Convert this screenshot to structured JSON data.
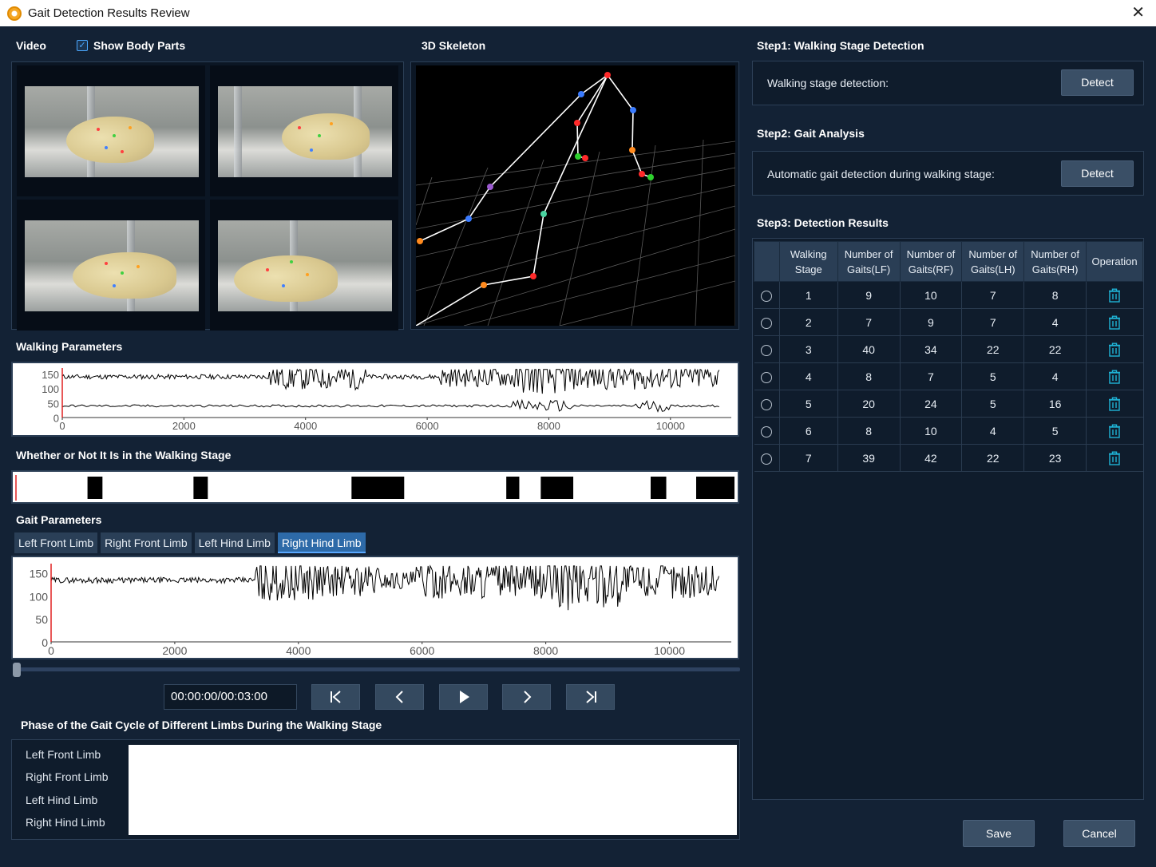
{
  "window": {
    "title": "Gait Detection Results Review",
    "close_glyph": "✕"
  },
  "video": {
    "title": "Video",
    "show_body_parts_label": "Show Body Parts",
    "show_body_parts_checked": true
  },
  "skeleton": {
    "title": "3D Skeleton"
  },
  "walking_params": {
    "title": "Walking Parameters",
    "chart_title_hidden": ""
  },
  "walking_stage": {
    "title": "Whether or Not It Is in the Walking Stage"
  },
  "gait_params": {
    "title": "Gait Parameters",
    "tabs": [
      "Left Front Limb",
      "Right Front Limb",
      "Left Hind Limb",
      "Right Hind Limb"
    ],
    "active_tab": 3
  },
  "playback": {
    "time": "00:00:00/00:03:00",
    "buttons": [
      "skip-to-start",
      "step-back",
      "play",
      "step-forward",
      "skip-to-end"
    ],
    "position_fraction": 0.0
  },
  "phase": {
    "title": "Phase of the Gait Cycle of Different Limbs During the Walking Stage",
    "limbs": [
      "Left Front Limb",
      "Right Front Limb",
      "Left Hind Limb",
      "Right Hind Limb"
    ]
  },
  "step1": {
    "title": "Step1: Walking Stage Detection",
    "text": "Walking stage detection:",
    "button": "Detect"
  },
  "step2": {
    "title": "Step2: Gait Analysis",
    "text": "Automatic gait detection during walking stage:",
    "button": "Detect"
  },
  "step3": {
    "title": "Step3: Detection Results",
    "headers": [
      "",
      "Walking Stage",
      "Number of Gaits(LF)",
      "Number of Gaits(RF)",
      "Number of Gaits(LH)",
      "Number of Gaits(RH)",
      "Operation"
    ],
    "header_lines": [
      [
        "",
        ""
      ],
      [
        "Walking",
        "Stage"
      ],
      [
        "Number of",
        "Gaits(LF)"
      ],
      [
        "Number of",
        "Gaits(RF)"
      ],
      [
        "Number of",
        "Gaits(LH)"
      ],
      [
        "Number of",
        "Gaits(RH)"
      ],
      [
        "Operation",
        ""
      ]
    ],
    "rows": [
      [
        "1",
        "9",
        "10",
        "7",
        "8"
      ],
      [
        "2",
        "7",
        "9",
        "7",
        "4"
      ],
      [
        "3",
        "40",
        "34",
        "22",
        "22"
      ],
      [
        "4",
        "8",
        "7",
        "5",
        "4"
      ],
      [
        "5",
        "20",
        "24",
        "5",
        "16"
      ],
      [
        "6",
        "8",
        "10",
        "4",
        "5"
      ],
      [
        "7",
        "39",
        "42",
        "22",
        "23"
      ]
    ]
  },
  "actions": {
    "save": "Save",
    "cancel": "Cancel"
  },
  "colors": {
    "accent": "#2d6aa8",
    "background": "#132235",
    "marker": "#e02020",
    "trash": "#1fb3d6"
  },
  "chart_data": [
    {
      "type": "line",
      "name": "walking-parameters",
      "title": "",
      "xlabel": "",
      "ylabel": "",
      "xlim": [
        0,
        11000
      ],
      "ylim": [
        0,
        170
      ],
      "xticks": [
        "0",
        "2000",
        "4000",
        "6000",
        "8000",
        "10000"
      ],
      "yticks": [
        "150",
        "100",
        "50",
        "0"
      ],
      "series_count": 2,
      "marker_x": 0
    },
    {
      "type": "bar",
      "name": "walking-stage",
      "title": "",
      "xlim": [
        0,
        11000
      ],
      "segments": [
        [
          1100,
          1330
        ],
        [
          2730,
          2950
        ],
        [
          5160,
          5970
        ],
        [
          7540,
          7740
        ],
        [
          8070,
          8570
        ],
        [
          9760,
          10000
        ],
        [
          10460,
          11390
        ]
      ]
    },
    {
      "type": "line",
      "name": "gait-parameters",
      "title": "",
      "xlim": [
        0,
        11000
      ],
      "ylim": [
        0,
        170
      ],
      "xticks": [
        "0",
        "2000",
        "4000",
        "6000",
        "8000",
        "10000"
      ],
      "yticks": [
        "150",
        "100",
        "50",
        "0"
      ],
      "marker_x": 0
    }
  ]
}
